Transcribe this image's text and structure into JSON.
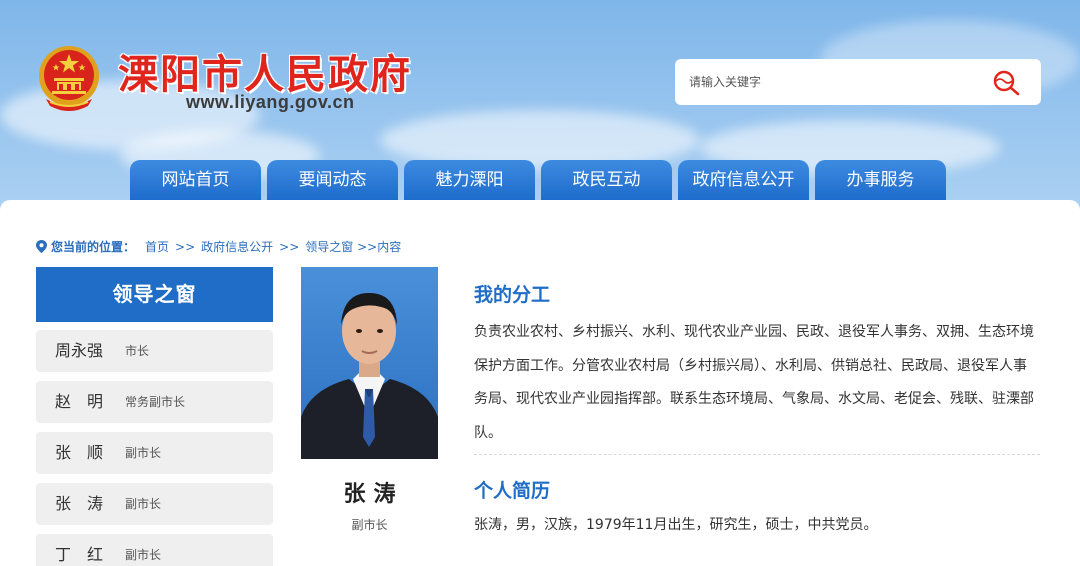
{
  "header": {
    "site_title": "溧阳市人民政府",
    "site_url": "www.liyang.gov.cn",
    "emblem_icon": "national-emblem-icon"
  },
  "search": {
    "placeholder": "请输入关键字",
    "icon": "search-icon"
  },
  "nav": {
    "tabs": [
      "网站首页",
      "要闻动态",
      "魅力溧阳",
      "政民互动",
      "政府信息公开",
      "办事服务"
    ]
  },
  "breadcrumb": {
    "label": "您当前的位置：",
    "items": [
      "首页",
      "政府信息公开",
      "领导之窗"
    ],
    "separator": ">>",
    "current": ">>内容"
  },
  "sidebar": {
    "title": "领导之窗",
    "items": [
      {
        "name": "周永强",
        "role": "市长"
      },
      {
        "name": "赵　明",
        "role": "常务副市长"
      },
      {
        "name": "张　顺",
        "role": "副市长"
      },
      {
        "name": "张　涛",
        "role": "副市长"
      },
      {
        "name": "丁　红",
        "role": "副市长"
      }
    ]
  },
  "profile": {
    "name": "张涛",
    "role": "副市长",
    "duties_title": "我的分工",
    "duties": "负责农业农村、乡村振兴、水利、现代农业产业园、民政、退役军人事务、双拥、生态环境保护方面工作。分管农业农村局（乡村振兴局）、水利局、供销总社、民政局、退役军人事务局、现代农业产业园指挥部。联系生态环境局、气象局、水文局、老促会、残联、驻溧部队。",
    "bio_title": "个人简历",
    "bio": "张涛，男，汉族，1979年11月出生，研究生，硕士，中共党员。"
  },
  "colors": {
    "brand_blue": "#1f6dc6",
    "title_red": "#e0251d"
  }
}
